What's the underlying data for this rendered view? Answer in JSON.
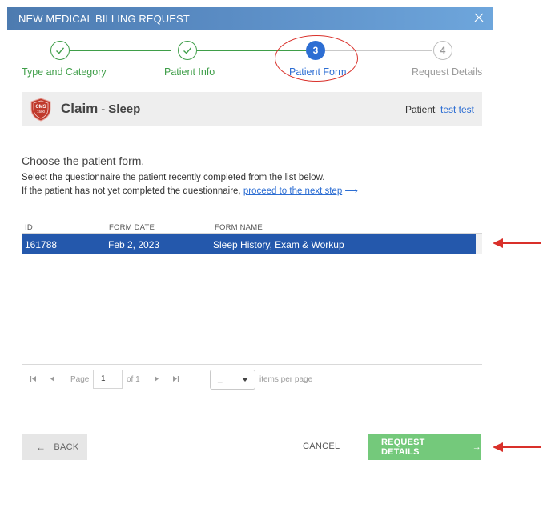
{
  "dialog": {
    "title": "NEW MEDICAL BILLING REQUEST"
  },
  "stepper": {
    "steps": [
      {
        "label": "Type and Category",
        "number": "",
        "state": "done"
      },
      {
        "label": "Patient Info",
        "number": "",
        "state": "done"
      },
      {
        "label": "Patient Form",
        "number": "3",
        "state": "active"
      },
      {
        "label": "Request Details",
        "number": "4",
        "state": "todo"
      }
    ]
  },
  "claim": {
    "badge_text": "CMS 1500",
    "title": "Claim",
    "separator": "-",
    "subtitle": "Sleep",
    "patient_label": "Patient",
    "patient_name": "test test"
  },
  "instructions": {
    "heading": "Choose the patient form.",
    "line1": "Select the questionnaire the patient recently completed from the list below.",
    "line2_prefix": "If the patient has not yet completed the questionnaire,",
    "line2_link": "proceed to the next step",
    "line2_arrow": "⟶"
  },
  "table": {
    "columns": [
      "ID",
      "FORM DATE",
      "FORM NAME"
    ],
    "rows": [
      {
        "id": "161788",
        "date": "Feb 2, 2023",
        "name": "Sleep History, Exam & Workup",
        "selected": true
      }
    ]
  },
  "pager": {
    "page_label": "Page",
    "page_value": "1",
    "of_label": "of 1",
    "per_page_value": "_",
    "per_page_label": "items per page"
  },
  "footer": {
    "back_label": "BACK",
    "back_icon": "←",
    "cancel_label": "CANCEL",
    "next_label": "REQUEST DETAILS",
    "next_icon": "→"
  },
  "colors": {
    "accent": "#2d6ed3",
    "done": "#3f9e49",
    "selected_row": "#2458ac",
    "primary_button": "#74c97b",
    "annotation": "#d9302a"
  }
}
